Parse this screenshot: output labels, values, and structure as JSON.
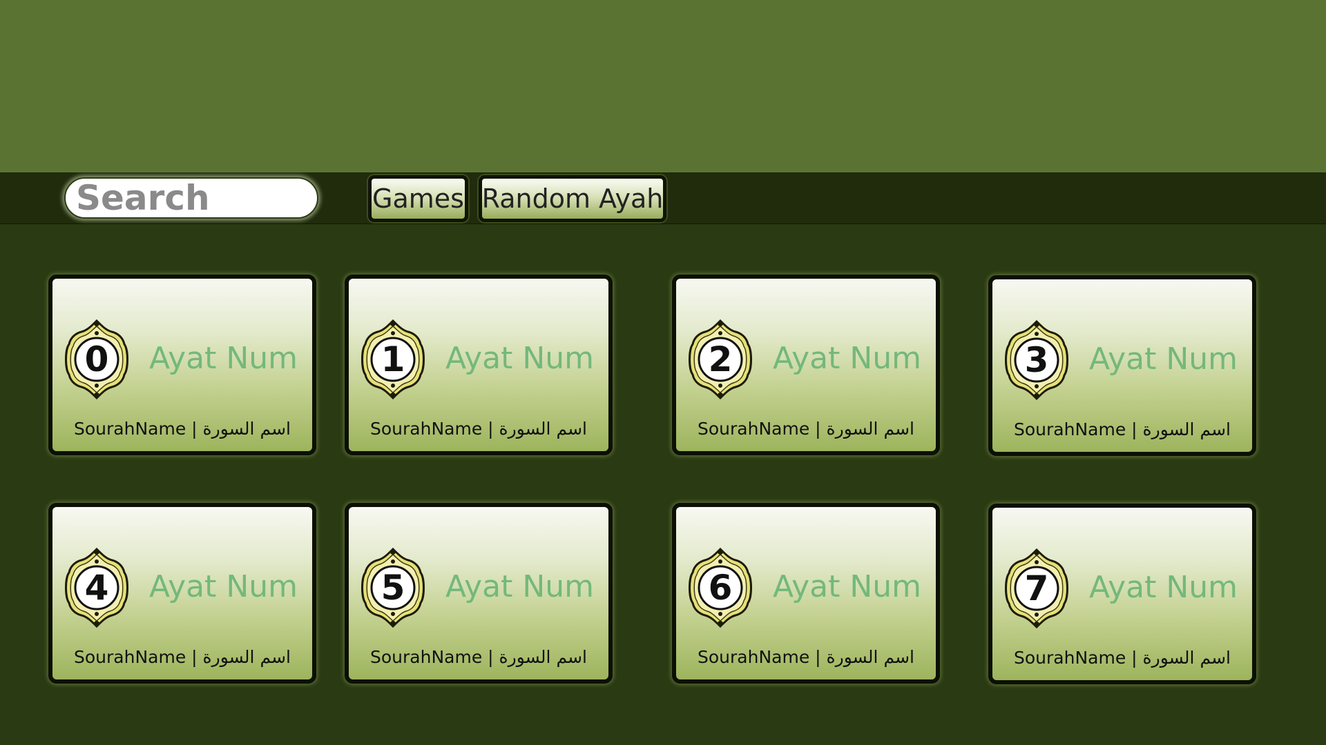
{
  "search": {
    "placeholder": "Search"
  },
  "toolbar": {
    "games_label": "Games",
    "random_label": "Random Ayah"
  },
  "colors": {
    "header": "#5a7333",
    "toolbar": "#212c0d",
    "background": "#2a3a12",
    "ayat_text": "#74b87b",
    "medal_gold": "#e6e07a"
  },
  "cards": [
    {
      "number": "0",
      "ayat": "Ayat Num",
      "sourah": "SourahName | اسم السورة",
      "icon": "medallion-icon"
    },
    {
      "number": "1",
      "ayat": "Ayat Num",
      "sourah": "SourahName | اسم السورة",
      "icon": "medallion-icon"
    },
    {
      "number": "2",
      "ayat": "Ayat Num",
      "sourah": "SourahName | اسم السورة",
      "icon": "medallion-icon"
    },
    {
      "number": "3",
      "ayat": "Ayat Num",
      "sourah": "SourahName | اسم السورة",
      "icon": "medallion-icon"
    },
    {
      "number": "4",
      "ayat": "Ayat Num",
      "sourah": "SourahName | اسم السورة",
      "icon": "medallion-icon"
    },
    {
      "number": "5",
      "ayat": "Ayat Num",
      "sourah": "SourahName | اسم السورة",
      "icon": "medallion-icon"
    },
    {
      "number": "6",
      "ayat": "Ayat Num",
      "sourah": "SourahName | اسم السورة",
      "icon": "medallion-icon"
    },
    {
      "number": "7",
      "ayat": "Ayat Num",
      "sourah": "SourahName | اسم السورة",
      "icon": "medallion-icon"
    }
  ]
}
